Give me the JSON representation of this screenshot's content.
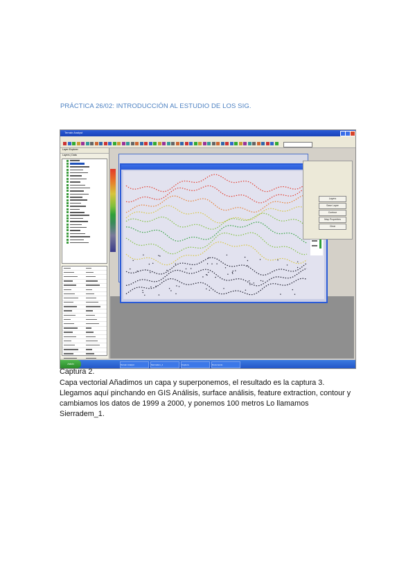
{
  "heading": "PRÁCTICA 26/02: INTRODUCCIÓN AL ESTUDIO DE LOS SIG.",
  "screenshot": {
    "app_title": "Terrain Analyst",
    "menu_items": [
      "File",
      "Map",
      "Edit",
      "View",
      "Tools",
      "Window",
      "Help"
    ],
    "left_panel_title": "Layer Explorer",
    "left_tabs": "Layers | Data",
    "map_window_title": "Sierradem_1",
    "right_buttons": [
      "Layers",
      "Save Layer",
      "Contour",
      "Map Properties",
      "Clear"
    ],
    "start_label": "Inicio",
    "taskbar_items": [
      "Terrain Analyst",
      "Sierradem_1",
      "Captura",
      "Documento"
    ],
    "colors": {
      "contour_high": "#e23a2a",
      "contour_mid_high": "#e87a2a",
      "contour_mid": "#d6c43a",
      "contour_low": "#7fbf3a",
      "contour_valley": "#2ea03a",
      "contour_base": "#1a1a2a",
      "title_blue": "#2a5bd7"
    }
  },
  "caption": {
    "label": "Captura 2.",
    "line1": "Capa vectorial  Añadimos un capa y superponemos, el resultado es la captura 3.",
    "line2": "Llegamos aquí pinchando en GIS Análisis, surface análisis, feature extraction, contour y",
    "line3": "cambiamos los datos de 1999  a 2000, y ponemos 100 metros  Lo llamamos",
    "line4": "Sierradem_1."
  }
}
